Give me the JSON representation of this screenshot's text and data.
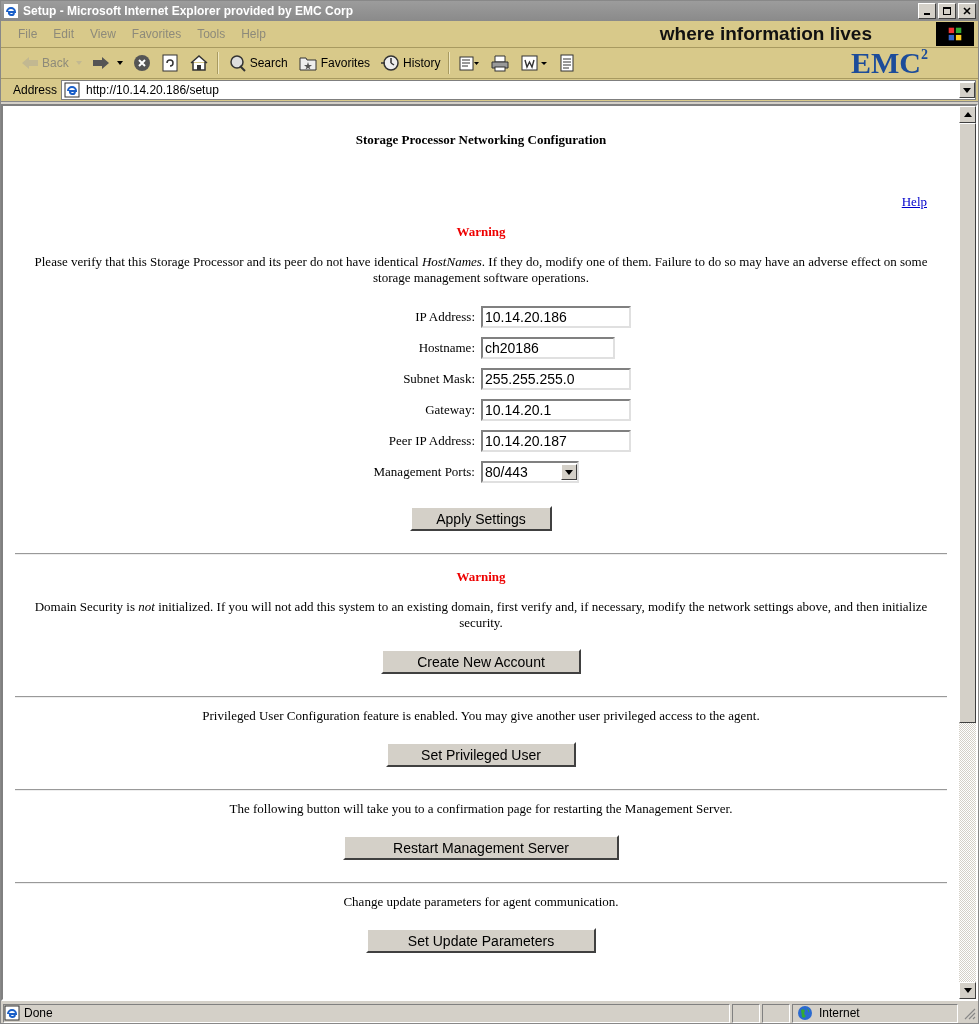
{
  "window": {
    "title": "Setup - Microsoft Internet Explorer provided by EMC Corp"
  },
  "menu": [
    "File",
    "Edit",
    "View",
    "Favorites",
    "Tools",
    "Help"
  ],
  "branding": {
    "tagline": "where information lives",
    "logo": "EMC",
    "logo_sup": "2"
  },
  "toolbar": [
    {
      "kind": "back",
      "label": "Back",
      "disabled": true
    },
    {
      "kind": "forward",
      "disabled": false
    },
    {
      "kind": "stop",
      "disabled": false
    },
    {
      "kind": "refresh",
      "disabled": false
    },
    {
      "kind": "home",
      "disabled": false
    },
    {
      "kind": "search",
      "label": "Search",
      "disabled": false
    },
    {
      "kind": "favorites",
      "label": "Favorites",
      "disabled": false
    },
    {
      "kind": "history",
      "label": "History",
      "disabled": false
    },
    {
      "kind": "mail",
      "disabled": false
    },
    {
      "kind": "print",
      "disabled": false
    },
    {
      "kind": "edit",
      "disabled": false
    },
    {
      "kind": "discuss",
      "disabled": false
    }
  ],
  "address": {
    "label": "Address",
    "value": "http://10.14.20.186/setup"
  },
  "page": {
    "title": "Storage Processor Networking Configuration",
    "help": "Help",
    "sections": [
      {
        "warning": "Warning",
        "message": "Please verify that this Storage Processor and its peer do not have identical *HostNames*. If they do, modify one of them. Failure to do so may have an adverse effect on some storage management software operations.",
        "fields": [
          {
            "kind": "text",
            "label": "IP Address:",
            "value": "10.14.20.186"
          },
          {
            "kind": "short",
            "label": "Hostname:",
            "value": "ch20186"
          },
          {
            "kind": "text",
            "label": "Subnet Mask:",
            "value": "255.255.255.0"
          },
          {
            "kind": "text",
            "label": "Gateway:",
            "value": "10.14.20.1"
          },
          {
            "kind": "text",
            "label": "Peer IP Address:",
            "value": "10.14.20.187"
          },
          {
            "kind": "select",
            "label": "Management Ports:",
            "value": "80/443"
          }
        ],
        "button": "Apply Settings"
      },
      {
        "warning": "Warning",
        "message": "Domain Security is *not* initialized. If you will not add this system to an existing domain, first verify and, if necessary, modify the network settings above, and then initialize security.",
        "button": "Create New Account"
      },
      {
        "message": "Privileged User Configuration feature is enabled. You may give another user privileged access to the agent.",
        "button": "Set Privileged User"
      },
      {
        "message": "The following button will take you to a confirmation page for restarting the Management Server.",
        "button": "Restart Management Server"
      },
      {
        "message": "Change update parameters for agent communication.",
        "button": "Set Update Parameters"
      }
    ]
  },
  "status_bar": {
    "text": "Done",
    "zone": "Internet"
  }
}
